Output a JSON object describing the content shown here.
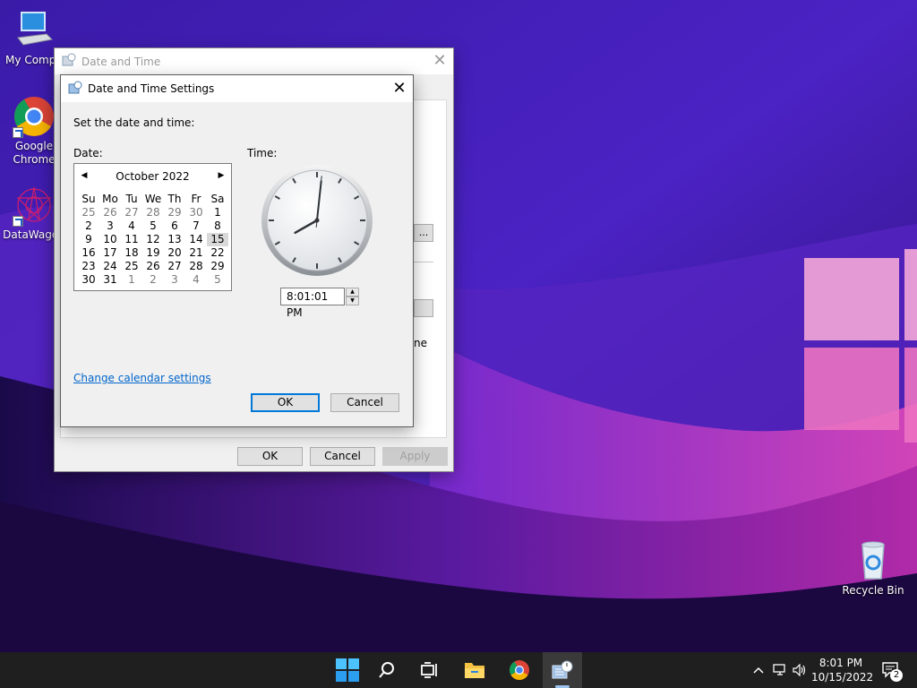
{
  "desktop": {
    "icons": [
      {
        "label": "My Compu"
      },
      {
        "label": "Google Chrome"
      },
      {
        "label": "DataWagon"
      },
      {
        "label": "Recycle Bin"
      }
    ]
  },
  "outer_dialog": {
    "title": "Date and Time",
    "partial_button_label": "...",
    "partial_text": "ne",
    "ok_label": "OK",
    "cancel_label": "Cancel",
    "apply_label": "Apply"
  },
  "inner_dialog": {
    "title": "Date and Time Settings",
    "instruction": "Set the date and time:",
    "date_label": "Date:",
    "time_label": "Time:",
    "calendar": {
      "month_label": "October 2022",
      "weekdays": [
        "Su",
        "Mo",
        "Tu",
        "We",
        "Th",
        "Fr",
        "Sa"
      ],
      "weeks": [
        [
          {
            "d": "25",
            "o": true
          },
          {
            "d": "26",
            "o": true
          },
          {
            "d": "27",
            "o": true
          },
          {
            "d": "28",
            "o": true
          },
          {
            "d": "29",
            "o": true
          },
          {
            "d": "30",
            "o": true
          },
          {
            "d": "1"
          }
        ],
        [
          {
            "d": "2"
          },
          {
            "d": "3"
          },
          {
            "d": "4"
          },
          {
            "d": "5"
          },
          {
            "d": "6"
          },
          {
            "d": "7"
          },
          {
            "d": "8"
          }
        ],
        [
          {
            "d": "9"
          },
          {
            "d": "10"
          },
          {
            "d": "11"
          },
          {
            "d": "12"
          },
          {
            "d": "13"
          },
          {
            "d": "14"
          },
          {
            "d": "15",
            "sel": true
          }
        ],
        [
          {
            "d": "16"
          },
          {
            "d": "17"
          },
          {
            "d": "18"
          },
          {
            "d": "19"
          },
          {
            "d": "20"
          },
          {
            "d": "21"
          },
          {
            "d": "22"
          }
        ],
        [
          {
            "d": "23"
          },
          {
            "d": "24"
          },
          {
            "d": "25"
          },
          {
            "d": "26"
          },
          {
            "d": "27"
          },
          {
            "d": "28"
          },
          {
            "d": "29"
          }
        ],
        [
          {
            "d": "30"
          },
          {
            "d": "31"
          },
          {
            "d": "1",
            "o": true
          },
          {
            "d": "2",
            "o": true
          },
          {
            "d": "3",
            "o": true
          },
          {
            "d": "4",
            "o": true
          },
          {
            "d": "5",
            "o": true
          }
        ]
      ]
    },
    "time_value": "8:01:01 PM",
    "clock": {
      "hour": 8,
      "minute": 1,
      "second": 1
    },
    "change_calendar_link": "Change calendar settings",
    "ok_label": "OK",
    "cancel_label": "Cancel"
  },
  "taskbar": {
    "time": "8:01 PM",
    "date": "10/15/2022",
    "notification_count": "2",
    "icons": [
      "windows-start-icon",
      "search-icon",
      "task-view-icon",
      "file-explorer-icon",
      "chrome-icon",
      "date-time-app-icon"
    ],
    "tray_icons": [
      "chevron-up-icon",
      "network-icon",
      "volume-icon",
      "notification-icon"
    ]
  },
  "colors": {
    "accent": "#0078d7",
    "link": "#0066cc",
    "taskbar": "#1f1f1f"
  }
}
